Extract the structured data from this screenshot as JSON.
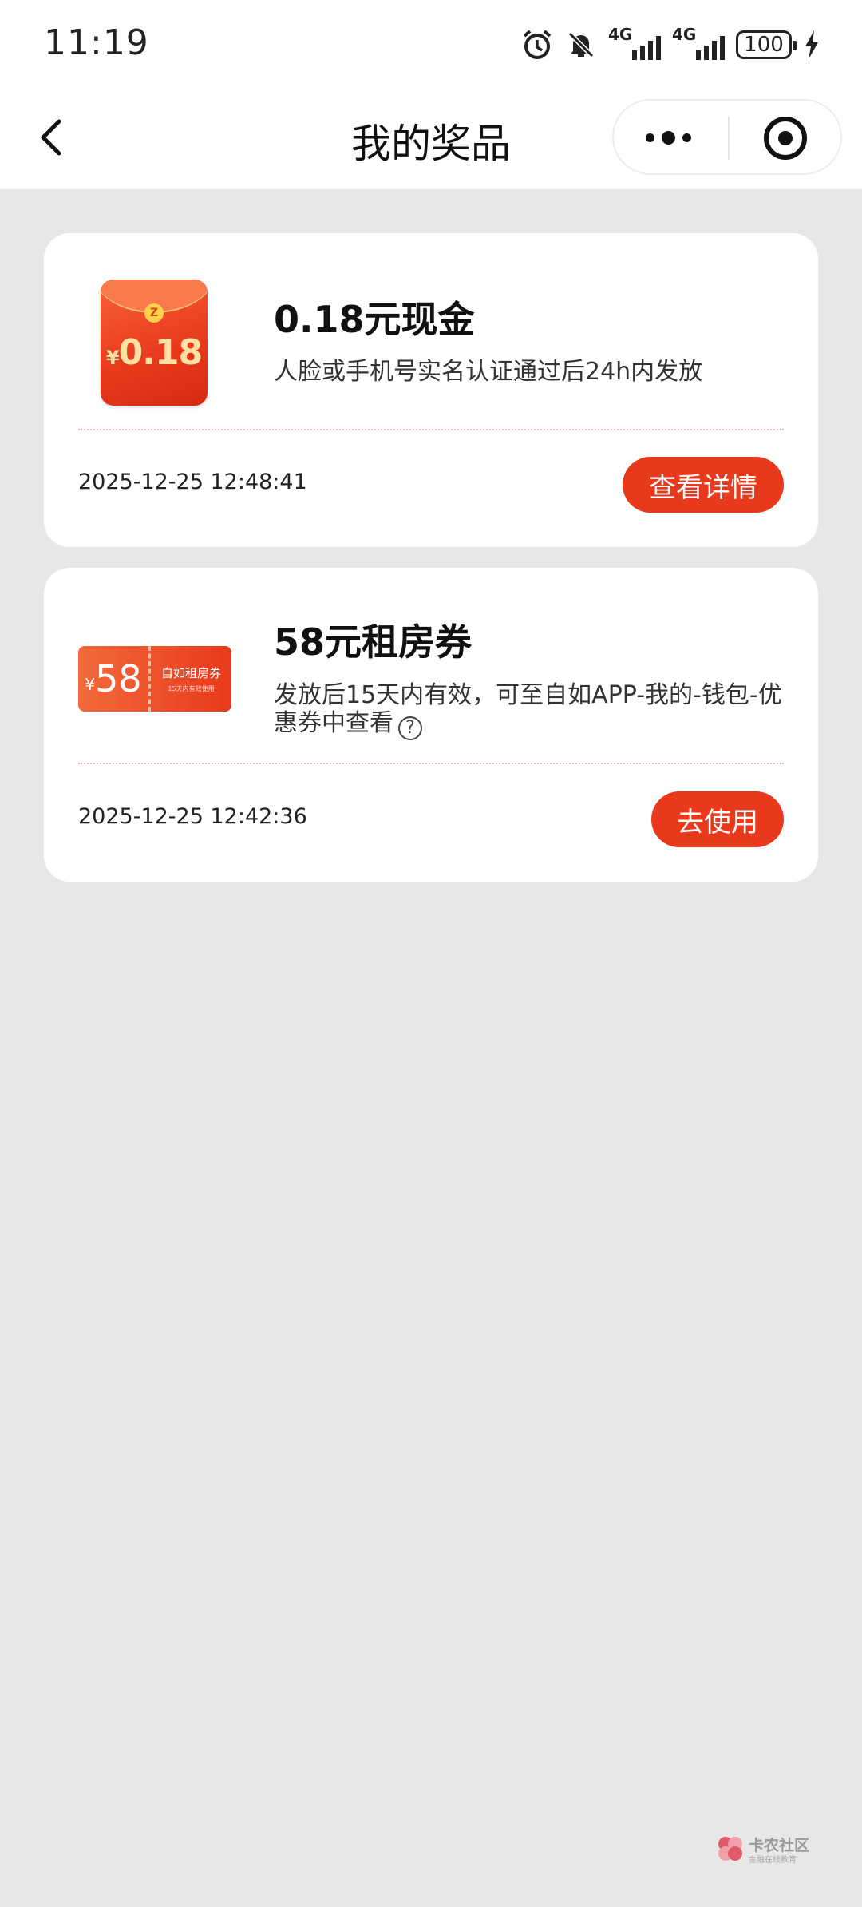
{
  "status_bar": {
    "time": "11:19",
    "network_1": "4G",
    "network_2": "4G",
    "battery": "100"
  },
  "nav": {
    "title": "我的奖品"
  },
  "prizes": [
    {
      "title": "0.18元现金",
      "description": "人脸或手机号实名认证通过后24h内发放",
      "timestamp": "2025-12-25 12:48:41",
      "button": "查看详情",
      "thumb_amount": "0.18",
      "thumb_currency": "¥",
      "thumb_coin": "Z"
    },
    {
      "title": "58元租房券",
      "description": "发放后15天内有效，可至自如APP-我的-钱包-优惠券中查看",
      "timestamp": "2025-12-25 12:42:36",
      "button": "去使用",
      "thumb_amount": "58",
      "thumb_currency": "¥",
      "thumb_label": "自如租房券",
      "thumb_sub": "15天内有效使用"
    }
  ],
  "watermark": {
    "name": "卡农社区",
    "sub": "金融在线教育"
  },
  "colors": {
    "accent": "#e8391c",
    "background": "#e7e7e7"
  }
}
